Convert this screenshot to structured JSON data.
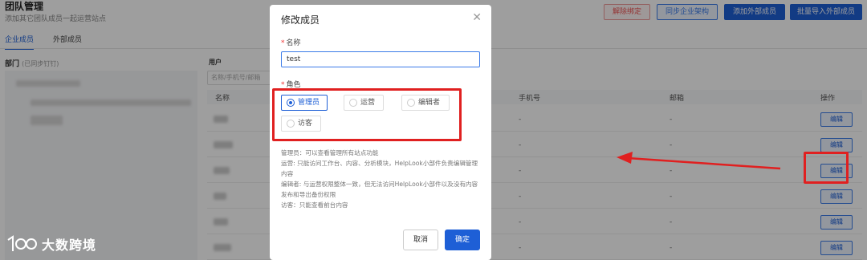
{
  "page": {
    "title": "团队管理",
    "subtitle": "添加其它团队成员一起运营站点",
    "buttons": {
      "remove_binding": "解除绑定",
      "sync_org": "同步企业架构",
      "add_external": "添加外部成员",
      "bulk_import_external": "批量导入外部成员"
    },
    "tabs": [
      "企业成员",
      "外部成员"
    ],
    "dept_title": "部门",
    "dept_note": "(已同步钉钉)",
    "user_title": "用户",
    "search_placeholder": "名称/手机号/邮箱",
    "columns": {
      "name": "名称",
      "phone": "手机号",
      "email": "邮箱",
      "action": "操作"
    },
    "rows": [
      {
        "phone": "-",
        "email": "-",
        "action": "编辑"
      },
      {
        "phone": "-",
        "email": "-",
        "action": "编辑"
      },
      {
        "phone": "-",
        "email": "-",
        "action": "编辑"
      },
      {
        "phone": "-",
        "email": "-",
        "action": "编辑"
      },
      {
        "phone": "-",
        "email": "-",
        "action": "编辑"
      },
      {
        "phone": "-",
        "email": "-",
        "action": "编辑"
      }
    ]
  },
  "modal": {
    "title": "修改成员",
    "name_label": "名称",
    "name_value": "test",
    "role_label": "角色",
    "roles": [
      "管理员",
      "运营",
      "编辑者",
      "访客"
    ],
    "selected_role": "管理员",
    "desc": [
      "管理员：可以查看管理所有站点功能",
      "运营: 只能访问工作台、内容、分析模块，HelpLook小部件负责编辑管理内容",
      "编辑者: 与运营权限整体一致，但无法访问HelpLook小部件以及没有内容发布和导出备份权限",
      "访客：只能查看前台内容"
    ],
    "cancel": "取消",
    "confirm": "确定"
  },
  "watermark": {
    "text": "大数跨境"
  },
  "colors": {
    "primary": "#1e5fd6",
    "annotation_red": "#e02020",
    "danger": "#e55555"
  }
}
